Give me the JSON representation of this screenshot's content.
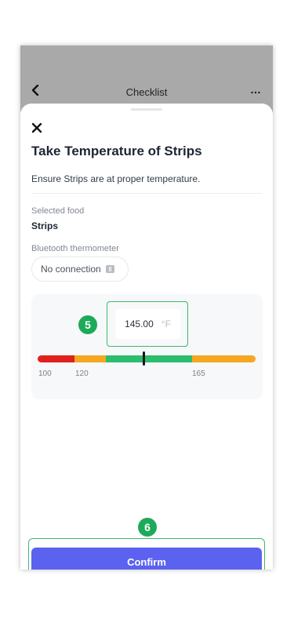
{
  "header": {
    "title": "Checklist",
    "back_icon": "chevron-left-icon",
    "more_label": "…",
    "background": "#a9a9a9"
  },
  "sheet": {
    "close_icon": "close-icon",
    "heading": "Take Temperature of Strips",
    "subtitle": "Ensure Strips are at proper temperature.",
    "selected_food_label": "Selected food",
    "selected_food_value": "Strips",
    "thermometer_label": "Bluetooth thermometer",
    "thermometer_status": "No connection",
    "bluetooth_icon": "bluetooth-icon"
  },
  "temperature": {
    "value": "145.00",
    "unit": "°F",
    "step_badge": "5",
    "scale_ticks": [
      "100",
      "120",
      "165"
    ],
    "scale_colors": {
      "low": "#e0201c",
      "warn": "#f5a623",
      "ok": "#2dbd6e",
      "high": "#f5a623"
    },
    "marker_value": 145
  },
  "footer": {
    "step_badge": "6",
    "confirm_label": "Confirm",
    "confirm_color": "#5b62f0",
    "highlight_color": "#3cb96c"
  }
}
